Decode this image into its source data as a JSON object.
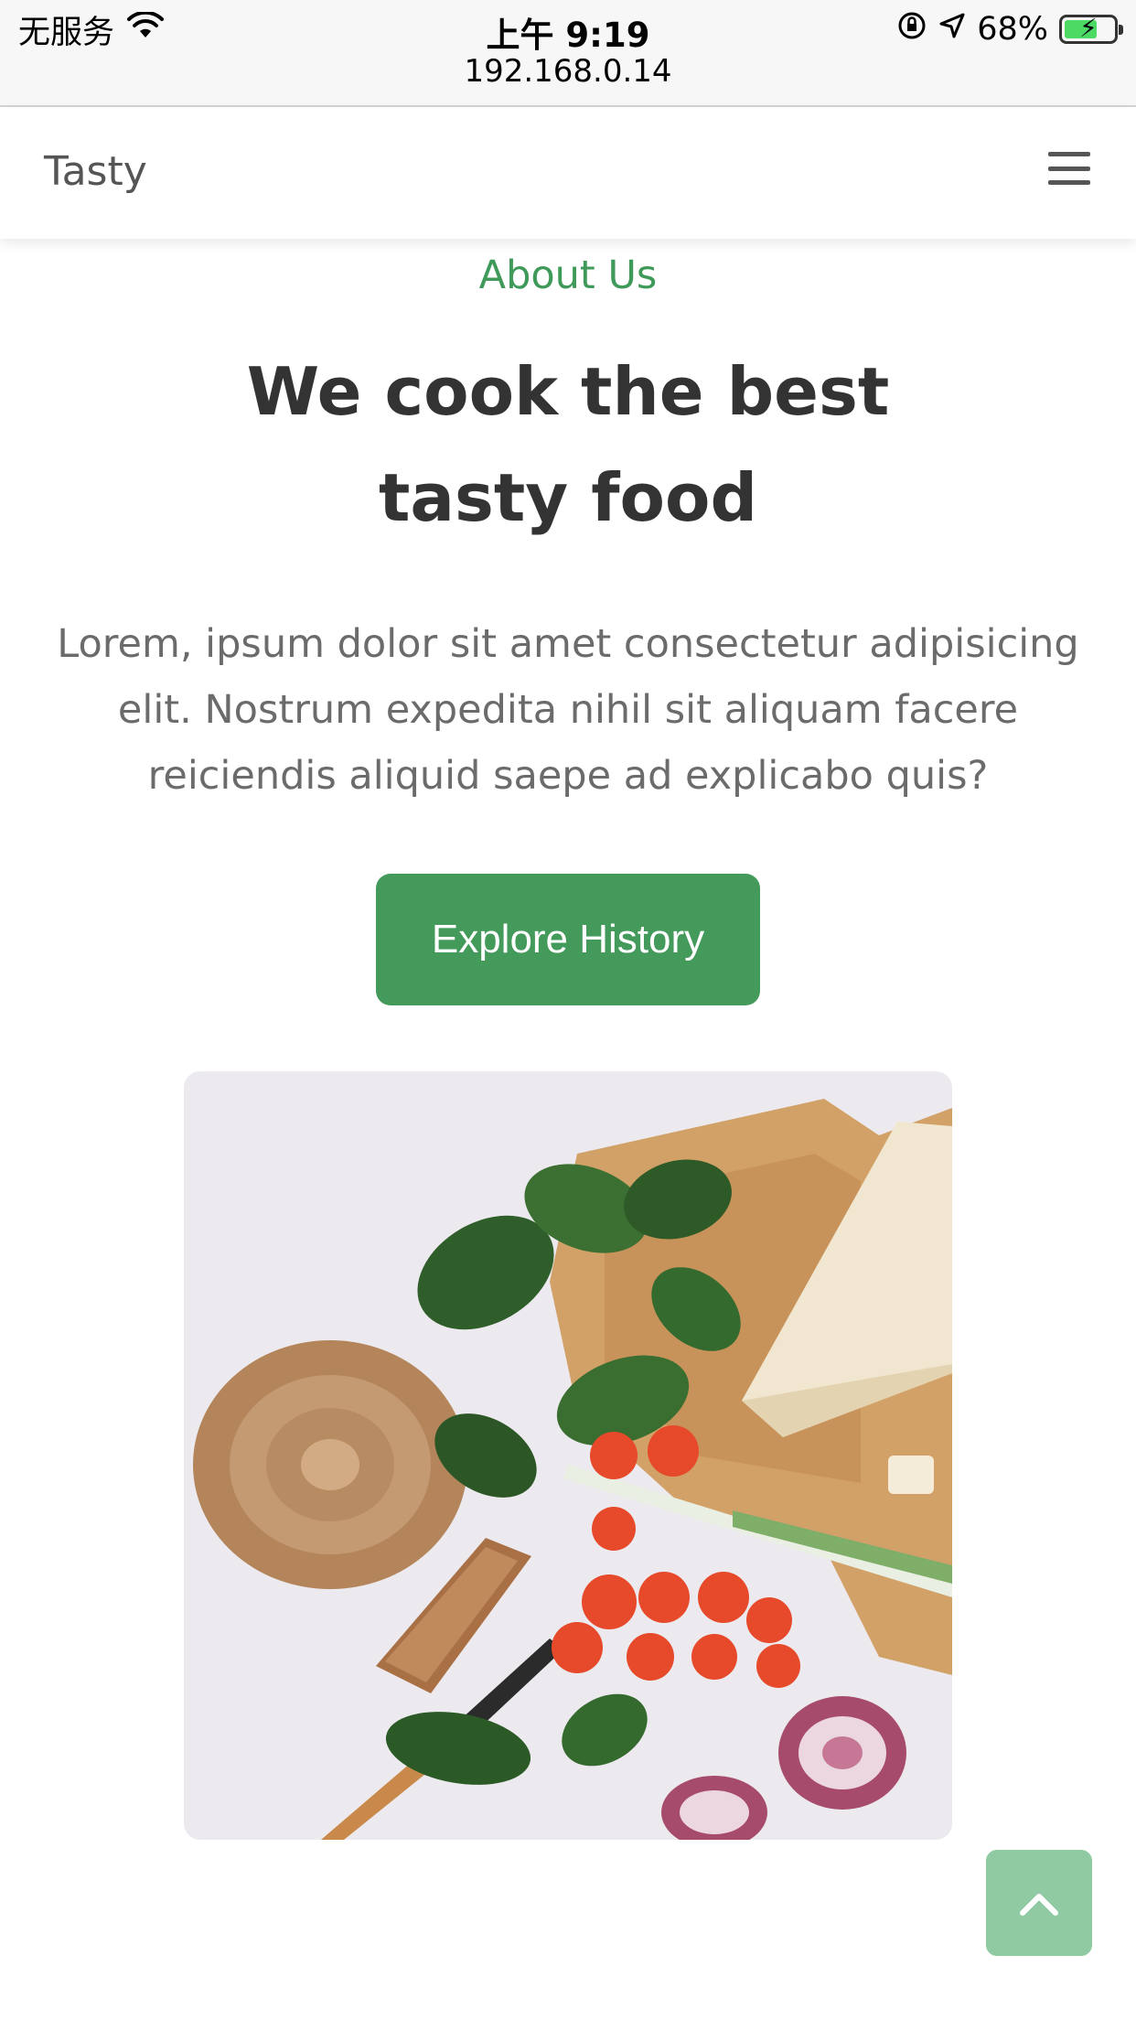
{
  "status_bar": {
    "carrier": "无服务",
    "time": "上午 9:19",
    "url": "192.168.0.14",
    "battery_percent": "68%",
    "battery_level": 0.68,
    "icons": [
      "wifi-icon",
      "orientation-lock-icon",
      "location-arrow-icon",
      "battery-charging-icon"
    ]
  },
  "navbar": {
    "brand": "Tasty",
    "menu_icon": "hamburger-menu-icon"
  },
  "about": {
    "subtitle": "About Us",
    "heading_line1": "We cook the best",
    "heading_line2": "tasty food",
    "paragraph": "Lorem, ipsum dolor sit amet consectetur adipisicing elit. Nostrum expedita nihil sit aliquam facere reiciendis aliquid saepe ad explicabo quis?",
    "button_label": "Explore History"
  },
  "image": {
    "icon": "food-photo"
  },
  "back_to_top": {
    "icon": "chevron-up-icon"
  },
  "colors": {
    "accent": "#439a5b",
    "accent_light": "#8fcaa2",
    "heading": "#333333",
    "body_text": "#6b6b6b"
  }
}
